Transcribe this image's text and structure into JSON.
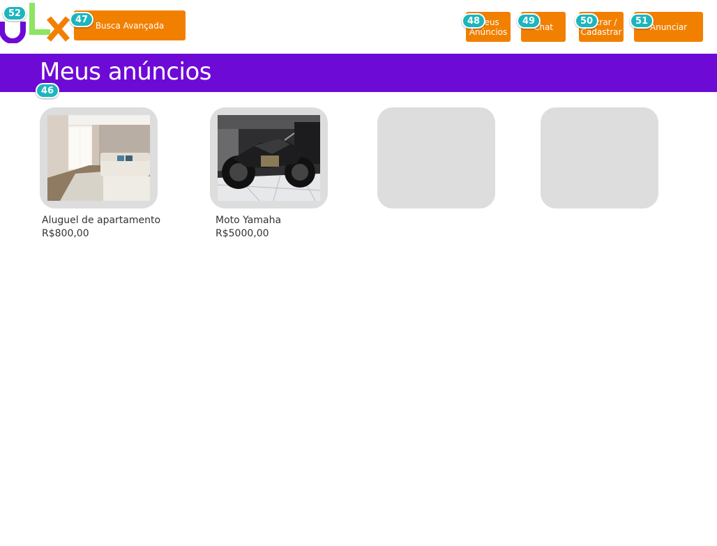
{
  "header": {
    "logo_alt": "OLX",
    "buttons": {
      "busca_avancada": "Busca Avançada",
      "meus_anuncios": "Meus Anúncios",
      "chat": "Chat",
      "entrar_cadastrar": "Entrar / Cadastrar",
      "anunciar": "Anunciar"
    },
    "badges": {
      "logo": "52",
      "busca_avancada": "47",
      "meus_anuncios": "48",
      "chat": "49",
      "entrar_cadastrar": "50",
      "anunciar": "51"
    }
  },
  "page": {
    "title": "Meus anúncios",
    "title_badge": "46"
  },
  "listings": [
    {
      "title": "Aluguel de apartamento",
      "price": "R$800,00",
      "image": "living-room-photo"
    },
    {
      "title": "Moto Yamaha",
      "price": "R$5000,00",
      "image": "motorcycle-photo"
    },
    {
      "title": "",
      "price": "",
      "image": "empty-placeholder"
    },
    {
      "title": "",
      "price": "",
      "image": "empty-placeholder"
    }
  ],
  "colors": {
    "brand_purple": "#6e0ad6",
    "brand_orange": "#f28000",
    "brand_green": "#8ce563",
    "badge_teal": "#1cb5bd",
    "card_gray": "#dddddd"
  }
}
